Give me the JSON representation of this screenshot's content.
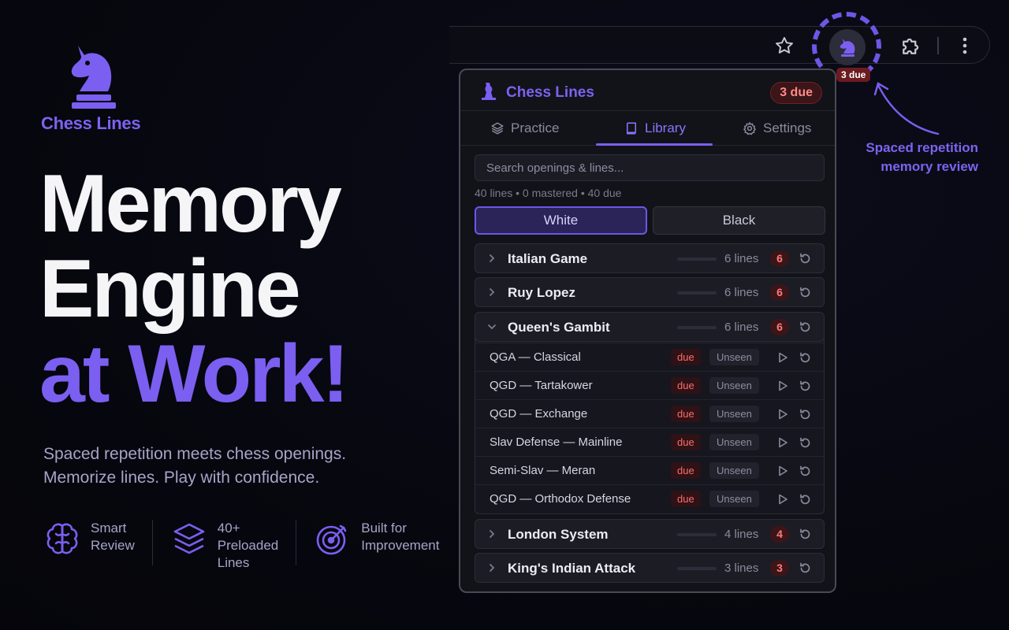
{
  "brand": {
    "name": "Chess Lines",
    "color": "#7b5ff0"
  },
  "headline": {
    "line1": "Memory",
    "line2": "Engine",
    "line3": "at Work!"
  },
  "tagline": {
    "line1": "Spaced repetition meets chess openings.",
    "line2": "Memorize lines. Play with confidence."
  },
  "features": [
    {
      "icon": "brain-icon",
      "label": "Smart\nReview"
    },
    {
      "icon": "layers-icon",
      "label": "40+\nPreloaded\nLines"
    },
    {
      "icon": "target-icon",
      "label": "Built for\nImprovement"
    }
  ],
  "browser": {
    "extension_badge": "3 due"
  },
  "annotation": {
    "line1": "Spaced repetition",
    "line2": "memory review"
  },
  "popup": {
    "title": "Chess Lines",
    "due_pill": "3 due",
    "tabs": [
      {
        "label": "Practice",
        "icon": "layers-icon"
      },
      {
        "label": "Library",
        "icon": "book-icon",
        "active": true
      },
      {
        "label": "Settings",
        "icon": "gear-icon"
      }
    ],
    "search_placeholder": "Search openings & lines...",
    "stats": "40 lines • 0 mastered • 40 due",
    "color_toggle": {
      "white": "White",
      "black": "Black",
      "selected": "White"
    },
    "groups": [
      {
        "name": "Italian Game",
        "count": "6 lines",
        "badge": "6",
        "expanded": false
      },
      {
        "name": "Ruy Lopez",
        "count": "6 lines",
        "badge": "6",
        "expanded": false
      },
      {
        "name": "Queen's Gambit",
        "count": "6 lines",
        "badge": "6",
        "expanded": true
      },
      {
        "name": "London System",
        "count": "4 lines",
        "badge": "4",
        "expanded": false
      },
      {
        "name": "King's Indian Attack",
        "count": "3 lines",
        "badge": "3",
        "expanded": false
      }
    ],
    "lines": [
      {
        "name": "QGA — Classical",
        "due": "due",
        "status": "Unseen"
      },
      {
        "name": "QGD — Tartakower",
        "due": "due",
        "status": "Unseen"
      },
      {
        "name": "QGD — Exchange",
        "due": "due",
        "status": "Unseen"
      },
      {
        "name": "Slav Defense — Mainline",
        "due": "due",
        "status": "Unseen"
      },
      {
        "name": "Semi-Slav — Meran",
        "due": "due",
        "status": "Unseen"
      },
      {
        "name": "QGD — Orthodox Defense",
        "due": "due",
        "status": "Unseen"
      }
    ]
  },
  "colors": {
    "accent": "#7b5ff0",
    "due_red": "#ff6b6b",
    "background": "#07070f"
  }
}
